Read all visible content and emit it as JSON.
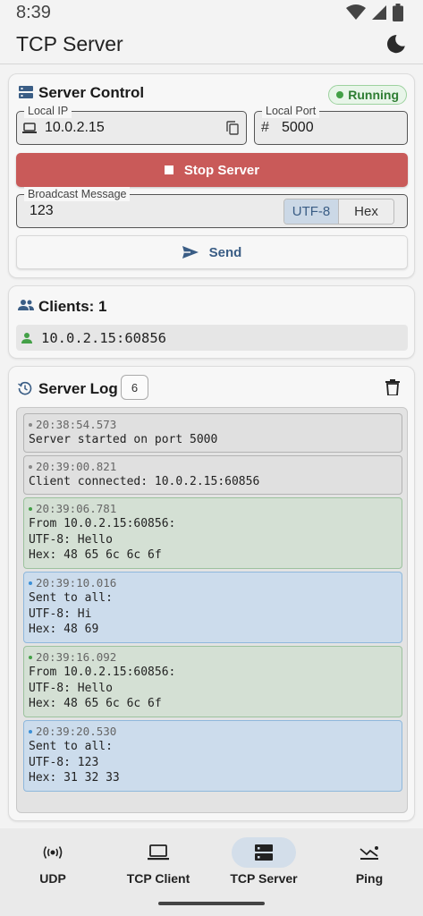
{
  "status_bar": {
    "time": "8:39"
  },
  "app_bar": {
    "title": "TCP Server",
    "theme_icon": "dark-mode-icon"
  },
  "server_control": {
    "title": "Server Control",
    "status_badge": "Running",
    "local_ip_label": "Local IP",
    "local_ip_value": "10.0.2.15",
    "local_port_label": "Local Port",
    "local_port_value": "5000",
    "stop_button": "Stop Server",
    "broadcast_label": "Broadcast Message",
    "broadcast_value": "123",
    "encoding_options": [
      "UTF-8",
      "Hex"
    ],
    "encoding_selected": "UTF-8",
    "send_button": "Send"
  },
  "clients": {
    "title": "Clients: 1",
    "items": [
      "10.0.2.15:60856"
    ]
  },
  "server_log": {
    "title": "Server Log",
    "count": "6",
    "entries": [
      {
        "type": "info",
        "timestamp": "20:38:54.573",
        "lines": [
          "Server started on port 5000"
        ]
      },
      {
        "type": "info",
        "timestamp": "20:39:00.821",
        "lines": [
          "Client connected: 10.0.2.15:60856"
        ]
      },
      {
        "type": "received",
        "timestamp": "20:39:06.781",
        "lines": [
          "From 10.0.2.15:60856:",
          "UTF-8: Hello",
          "Hex: 48 65 6c 6c 6f"
        ]
      },
      {
        "type": "sent",
        "timestamp": "20:39:10.016",
        "lines": [
          "Sent to all:",
          "UTF-8: Hi",
          "Hex: 48 69"
        ]
      },
      {
        "type": "received",
        "timestamp": "20:39:16.092",
        "lines": [
          "From 10.0.2.15:60856:",
          "UTF-8: Hello",
          "Hex: 48 65 6c 6c 6f"
        ]
      },
      {
        "type": "sent",
        "timestamp": "20:39:20.530",
        "lines": [
          "Sent to all:",
          "UTF-8: 123",
          "Hex: 31 32 33"
        ]
      }
    ]
  },
  "bottom_nav": {
    "items": [
      {
        "label": "UDP",
        "icon": "broadcast-icon"
      },
      {
        "label": "TCP Client",
        "icon": "laptop-icon"
      },
      {
        "label": "TCP Server",
        "icon": "server-icon"
      },
      {
        "label": "Ping",
        "icon": "ping-icon"
      }
    ],
    "selected": "TCP Server"
  },
  "colors": {
    "accent": "#3a5d85",
    "stop": "#c95a59",
    "running": "#2e7d32",
    "log_received": "#d4e0d4",
    "log_sent": "#ccdcec"
  }
}
